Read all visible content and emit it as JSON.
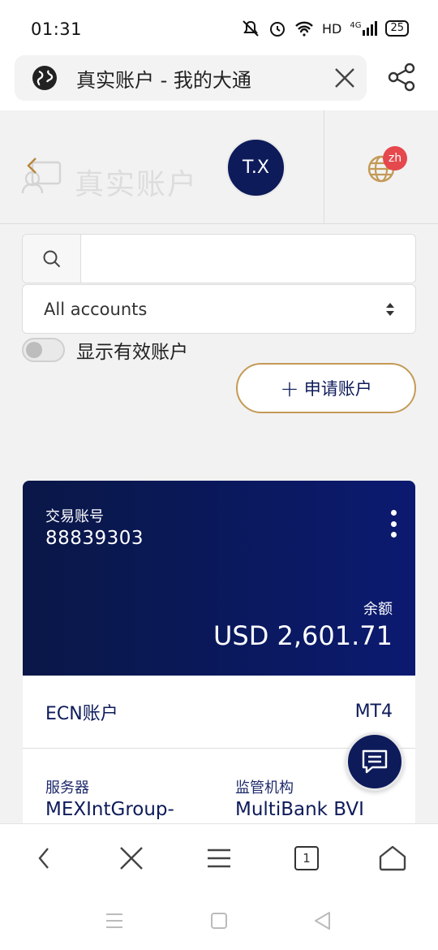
{
  "status": {
    "time": "01:31",
    "network": "HD",
    "signal": "4G",
    "battery": "25"
  },
  "browser": {
    "tab_title": "真实账户 - 我的大通",
    "tab_count": "1"
  },
  "header": {
    "faded_title": "真实账户",
    "avatar_initials": "T.X",
    "lang_badge": "zh"
  },
  "filters": {
    "search_placeholder": "",
    "account_filter": "All accounts",
    "toggle_label": "显示有效账户",
    "apply_button": "申请账户"
  },
  "card": {
    "account_label": "交易账号",
    "account_number": "88839303",
    "balance_label": "余额",
    "balance_value": "USD 2,601.71",
    "account_type": "ECN账户",
    "platform": "MT4",
    "server_label": "服务器",
    "server_value": "MEXIntGroup-",
    "regulator_label": "监管机构",
    "regulator_value": "MultiBank BVI"
  },
  "colors": {
    "navy": "#0e1b5a",
    "gold": "#c49a56",
    "badge": "#e5484d"
  }
}
